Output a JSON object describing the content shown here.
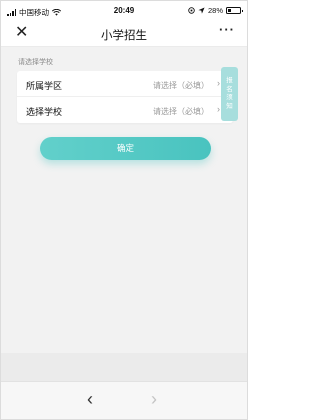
{
  "status_bar": {
    "carrier": "中国移动",
    "time": "20:49",
    "battery": "28%",
    "battery_level": 0.28
  },
  "nav": {
    "close_icon": "✕",
    "title": "小学招生",
    "more_icon": "···"
  },
  "form": {
    "section_label": "请选择学校",
    "rows": [
      {
        "label": "所属学区",
        "value": "请选择（必填）",
        "chevron": "›"
      },
      {
        "label": "选择学校",
        "value": "请选择（必填）",
        "chevron": "›"
      }
    ]
  },
  "side_tab": {
    "chars": [
      "报",
      "名",
      "须",
      "知"
    ]
  },
  "confirm_label": "确定",
  "browser_nav": {
    "back": "‹",
    "forward": "›"
  },
  "colors": {
    "accent": "#4ec5c1",
    "side_tab": "#a7dedd"
  }
}
